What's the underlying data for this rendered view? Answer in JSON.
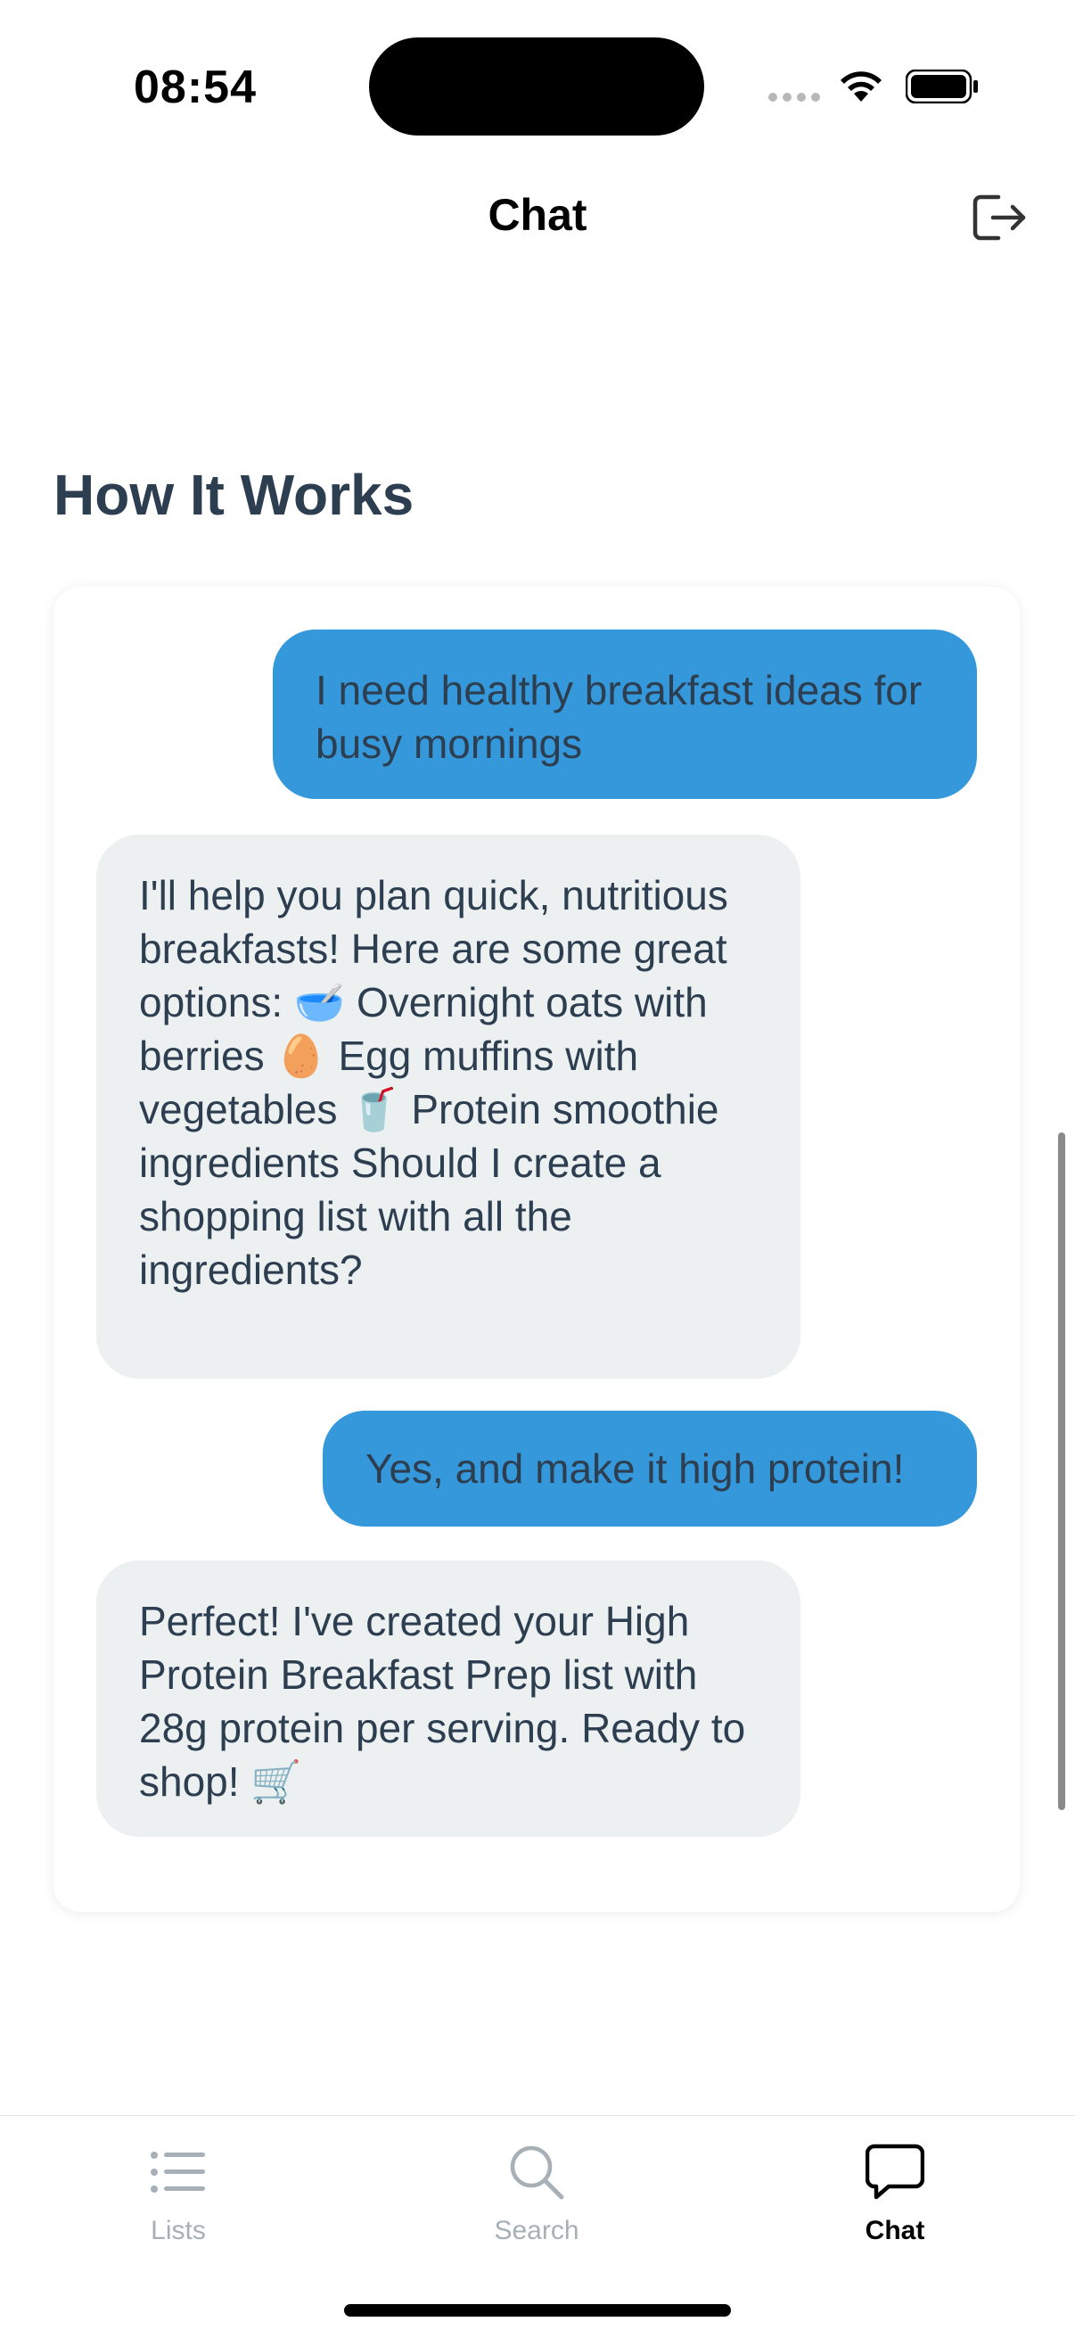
{
  "status_bar": {
    "time": "08:54"
  },
  "header": {
    "title": "Chat"
  },
  "section": {
    "heading": "How It Works"
  },
  "messages": [
    {
      "role": "user",
      "text": "I need healthy breakfast ideas for busy mornings"
    },
    {
      "role": "assistant",
      "text": "I'll help you plan quick, nutritious breakfasts! Here are some great options: 🥣 Overnight oats with berries 🥚 Egg muffins with vegetables 🥤 Protein smoothie ingredients Should I create a shopping list with all the ingredients?"
    },
    {
      "role": "user",
      "text": "Yes, and make it high protein!"
    },
    {
      "role": "assistant",
      "text": "Perfect! I've created your High Protein Breakfast Prep list with 28g protein per serving. Ready to shop! 🛒"
    }
  ],
  "tabs": [
    {
      "label": "Lists",
      "icon": "list-icon",
      "active": false
    },
    {
      "label": "Search",
      "icon": "search-icon",
      "active": false
    },
    {
      "label": "Chat",
      "icon": "chat-bubble-icon",
      "active": true
    }
  ],
  "colors": {
    "user_bubble": "#3498db",
    "assistant_bubble": "#ecf0f1",
    "heading_text": "#2c3e50",
    "inactive_tab": "#a7b0b6"
  }
}
